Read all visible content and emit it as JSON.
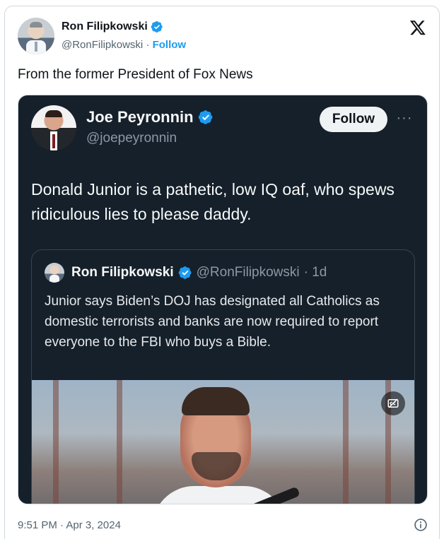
{
  "author": {
    "name": "Ron Filipkowski",
    "handle": "@RonFilipkowski",
    "separator": "·",
    "follow_label": "Follow"
  },
  "tweet": {
    "text": "From the former President of Fox News",
    "timestamp": "9:51 PM · Apr 3, 2024"
  },
  "embedded": {
    "name": "Joe Peyronnin",
    "handle": "@joepeyronnin",
    "follow_label": "Follow",
    "more_label": "···",
    "text": "Donald Junior is a pathetic, low IQ oaf, who spews ridiculous lies to please daddy.",
    "quote": {
      "name": "Ron Filipkowski",
      "handle": "@RonFilipkowski",
      "age": "· 1d",
      "text": "Junior says Biden’s DOJ has designated all Catholics as domestic terrorists and banks are now required to report everyone to the FBI who buys a Bible."
    }
  },
  "icons": {
    "verified": "verified-badge-icon",
    "x_logo": "x-logo-icon",
    "captions": "closed-captions-icon",
    "info": "info-icon"
  },
  "colors": {
    "accent": "#1d9bf0",
    "dark_bg": "#15202b"
  }
}
